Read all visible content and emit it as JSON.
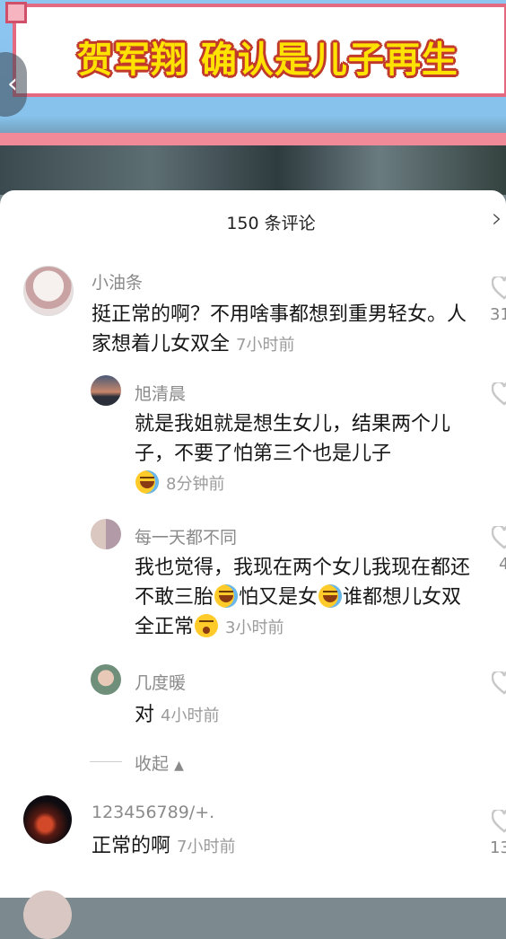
{
  "video": {
    "banner_title": "贺军翔 确认是儿子再生",
    "back_icon": "chevron-left-icon"
  },
  "comments_panel": {
    "title": "150 条评论",
    "close_icon": "close-icon"
  },
  "comments": [
    {
      "user": "小油条",
      "text": "挺正常的啊？不用啥事都想到重男轻女。人家想着儿女双全",
      "time": "7小时前",
      "like_count": "31",
      "replies": [
        {
          "user": "旭清晨",
          "text": "就是我姐就是想生女儿，结果两个儿子，不要了怕第三个也是儿子",
          "time": "8分钟前"
        },
        {
          "user": "每一天都不同",
          "text_a": "我也觉得，我现在两个女儿我现在都还不敢三胎",
          "text_b": "怕又是女",
          "text_c": "谁都想儿女双全正常",
          "time": "3小时前",
          "like_count": "4"
        },
        {
          "user": "几度暖",
          "text": "对",
          "time": "4小时前"
        }
      ],
      "collapse_label": "收起"
    },
    {
      "user": "123456789/+.",
      "text": "正常的啊",
      "time": "7小时前",
      "like_count": "13"
    }
  ]
}
